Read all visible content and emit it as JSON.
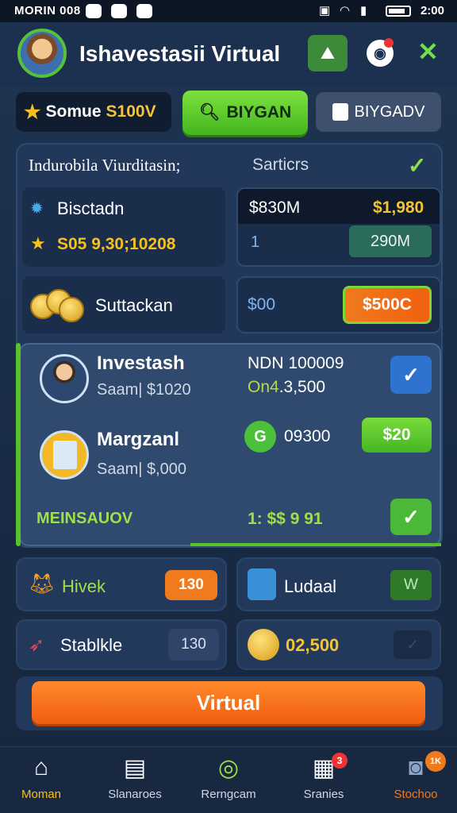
{
  "status_bar": {
    "carrier": "MORIN 008",
    "time": "2:00"
  },
  "header": {
    "title": "Ishavestasii Virtual"
  },
  "top_row": {
    "bonus_label": "Somue",
    "bonus_amount": "S100V",
    "primary_button": "BIYGAN",
    "secondary_button": "BIYGADV"
  },
  "panel": {
    "heading_left": "Indurobila Viurditasin;",
    "heading_right": "Sarticrs",
    "card1": {
      "label": "Bisctadn",
      "amount": "S05 9,30;10208"
    },
    "card2": {
      "left": "$830M",
      "right": "$1,980",
      "row_num": "1",
      "pill": "290M"
    },
    "card3": {
      "label": "Suttackan"
    },
    "card4": {
      "left": "$00",
      "button": "$500C"
    },
    "invest": {
      "name": "Investash",
      "sub": "Saam| $1020",
      "mid_line1": "NDN 100009",
      "mid_prefix": "On4",
      "mid_value": ".3,500"
    },
    "margin": {
      "name": "Margzanl",
      "sub": "Saam| $,000",
      "mid": "09300",
      "button": "$20"
    },
    "mens": {
      "label": "MEINSAUOV",
      "mid": "1: $$ 9 91"
    }
  },
  "tiles": {
    "hivek": {
      "label": "Hivek",
      "pill": "130"
    },
    "ludaal": {
      "label": "Ludaal",
      "pill": "W"
    },
    "stabkle": {
      "label": "Stablkle",
      "pill": "130"
    },
    "coins": {
      "label": "02,500"
    }
  },
  "main_button": "Virtual",
  "nav": [
    {
      "label": "Moman",
      "icon": "home-icon"
    },
    {
      "label": "Slanaroes",
      "icon": "calendar-icon"
    },
    {
      "label": "Rerngcam",
      "icon": "compass-icon"
    },
    {
      "label": "Sranies",
      "icon": "grid-icon",
      "badge": "3"
    },
    {
      "label": "Stochoo",
      "icon": "profile-icon",
      "badge": "1K"
    }
  ],
  "colors": {
    "accent_green": "#58c22a",
    "accent_orange": "#f07a1e",
    "gold": "#f3c436",
    "bg": "#1f3552"
  }
}
